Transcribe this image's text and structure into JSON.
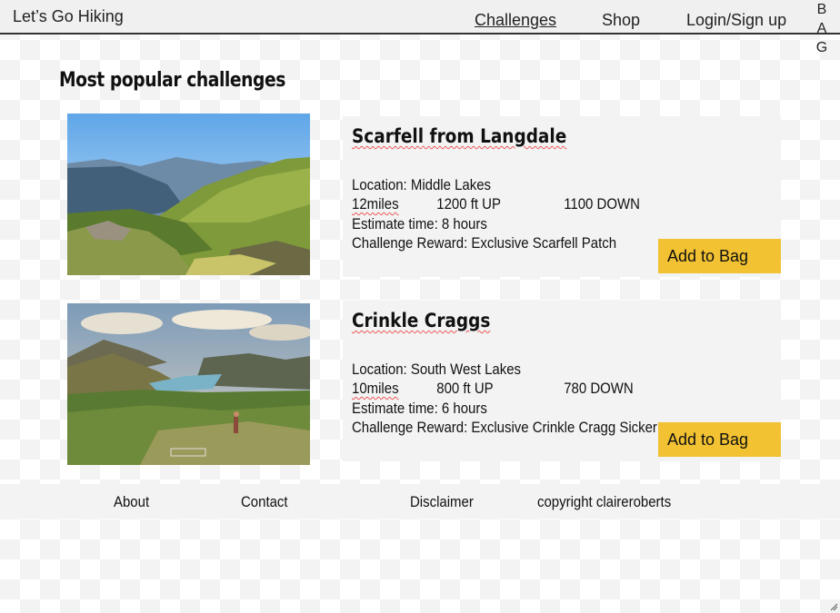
{
  "header": {
    "brand": "Let’s Go Hiking",
    "nav": {
      "challenges": "Challenges",
      "shop": "Shop",
      "login": "Login/Sign up",
      "bag_letters": [
        "B",
        "A",
        "G"
      ]
    }
  },
  "page_title": "Most popular challenges",
  "challenges": [
    {
      "title": "Scarfell from Langdale",
      "location": "Location: Middle Lakes",
      "miles": "12miles",
      "up": "1200 ft UP",
      "down": "1100 DOWN",
      "time": "Estimate time: 8 hours",
      "reward": "Challenge Reward: Exclusive Scarfell Patch",
      "button": "Add to Bag"
    },
    {
      "title": "Crinkle Craggs",
      "location": "Location: South West Lakes",
      "miles": "10miles",
      "up": "800 ft UP",
      "down": "780 DOWN",
      "time": "Estimate time: 6 hours",
      "reward": "Challenge Reward: Exclusive Crinkle Cragg Sicker",
      "button": "Add to Bag"
    }
  ],
  "footer": {
    "about": "About",
    "contact": "Contact",
    "disclaimer": "Disclaimer",
    "copyright": "copyright claireroberts"
  },
  "colors": {
    "button": "#f2c232",
    "card_bg": "#f3f3f3",
    "header_bg": "#f0f0f0"
  }
}
